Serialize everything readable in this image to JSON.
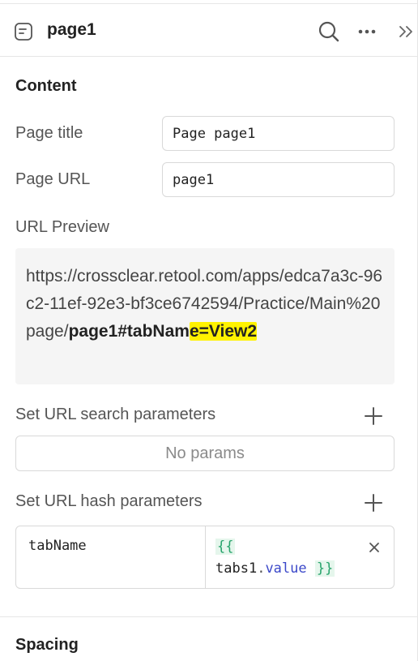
{
  "header": {
    "page_name": "page1"
  },
  "content": {
    "section_title": "Content",
    "page_title_label": "Page title",
    "page_title_value": "Page page1",
    "page_url_label": "Page URL",
    "page_url_value": "page1",
    "url_preview_label": "URL Preview",
    "url_preview": {
      "base": "https://crossclear.retool.com/apps/edca7a3c-96c2-11ef-92e3-bf3ce6742594/Practice/Main%20page/",
      "page_part": "page1#tabNam",
      "highlighted_part": "e=View2"
    }
  },
  "search_params": {
    "label": "Set URL search parameters",
    "empty_text": "No params"
  },
  "hash_params": {
    "label": "Set URL hash parameters",
    "rows": [
      {
        "key": "tabName",
        "open_brace": "{{",
        "object": "tabs1",
        "dot": ".",
        "property": "value",
        "close_brace": "}}"
      }
    ]
  },
  "spacing": {
    "section_title": "Spacing"
  },
  "icons": {
    "page": "document-icon",
    "search": "search-icon",
    "more": "more-horizontal-icon",
    "collapse": "double-chevron-right-icon",
    "add": "plus-icon",
    "clear": "close-icon"
  },
  "colors": {
    "highlight": "#fff200",
    "brace_green": "#27a36b",
    "property_blue": "#3b48c9"
  }
}
